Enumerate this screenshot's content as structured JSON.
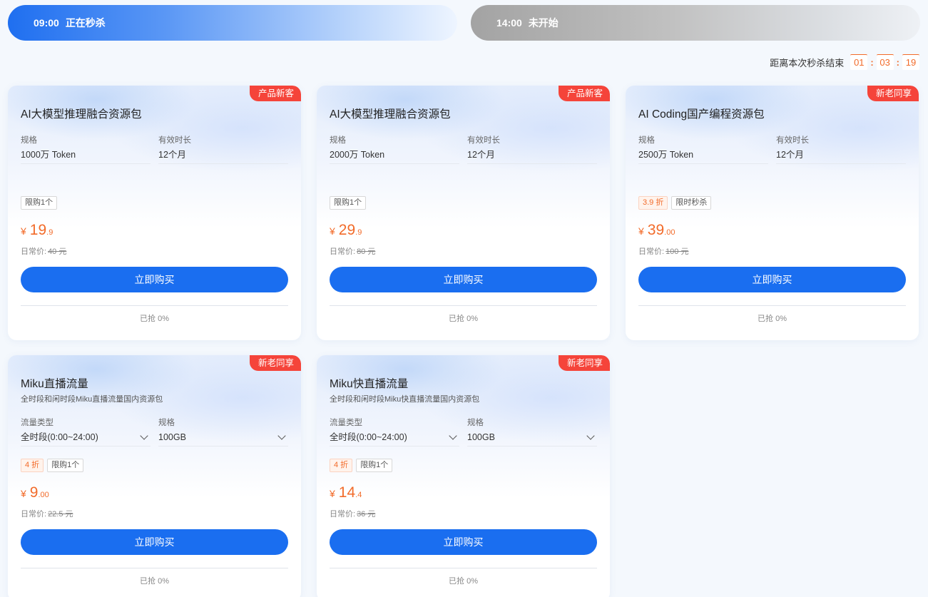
{
  "tabs": [
    {
      "time": "09:00",
      "status": "正在秒杀"
    },
    {
      "time": "14:00",
      "status": "未开始"
    }
  ],
  "countdown": {
    "label": "距离本次秒杀结束",
    "hours": "01",
    "minutes": "03",
    "seconds": "19"
  },
  "colors": {
    "accent": "#1a6ef0",
    "price": "#f26b2a",
    "badge": "#f5443a"
  },
  "cards": [
    {
      "badge": "产品新客",
      "title": "AI大模型推理融合资源包",
      "spec1_label": "规格",
      "spec1_value": "1000万 Token",
      "spec2_label": "有效时长",
      "spec2_value": "12个月",
      "tag_limit": "限购1个",
      "price_currency": "¥",
      "price_int": "19",
      "price_dec": ".9",
      "orig_label": "日常价:",
      "orig_value": "40 元",
      "buy_label": "立即购买",
      "sold": "已抢 0%"
    },
    {
      "badge": "产品新客",
      "title": "AI大模型推理融合资源包",
      "spec1_label": "规格",
      "spec1_value": "2000万 Token",
      "spec2_label": "有效时长",
      "spec2_value": "12个月",
      "tag_limit": "限购1个",
      "price_currency": "¥",
      "price_int": "29",
      "price_dec": ".9",
      "orig_label": "日常价:",
      "orig_value": "80 元",
      "buy_label": "立即购买",
      "sold": "已抢 0%"
    },
    {
      "badge": "新老同享",
      "title": "AI Coding国产编程资源包",
      "spec1_label": "规格",
      "spec1_value": "2500万 Token",
      "spec2_label": "有效时长",
      "spec2_value": "12个月",
      "tag_discount": "3.9 折",
      "tag_limit": "限时秒杀",
      "price_currency": "¥",
      "price_int": "39",
      "price_dec": ".00",
      "orig_label": "日常价:",
      "orig_value": "100 元",
      "buy_label": "立即购买",
      "sold": "已抢 0%"
    },
    {
      "badge": "新老同享",
      "title": "Miku直播流量",
      "desc": "全时段和闲时段Miku直播流量国内资源包",
      "spec1_label": "流量类型",
      "spec1_value": "全时段(0:00~24:00)",
      "spec2_label": "规格",
      "spec2_value": "100GB",
      "tag_discount": "4 折",
      "tag_limit": "限购1个",
      "price_currency": "¥",
      "price_int": "9",
      "price_dec": ".00",
      "orig_label": "日常价:",
      "orig_value": "22.5 元",
      "buy_label": "立即购买",
      "sold": "已抢 0%"
    },
    {
      "badge": "新老同享",
      "title": "Miku快直播流量",
      "desc": "全时段和闲时段Miku快直播流量国内资源包",
      "spec1_label": "流量类型",
      "spec1_value": "全时段(0:00~24:00)",
      "spec2_label": "规格",
      "spec2_value": "100GB",
      "tag_discount": "4 折",
      "tag_limit": "限购1个",
      "price_currency": "¥",
      "price_int": "14",
      "price_dec": ".4",
      "orig_label": "日常价:",
      "orig_value": "36 元",
      "buy_label": "立即购买",
      "sold": "已抢 0%"
    }
  ]
}
